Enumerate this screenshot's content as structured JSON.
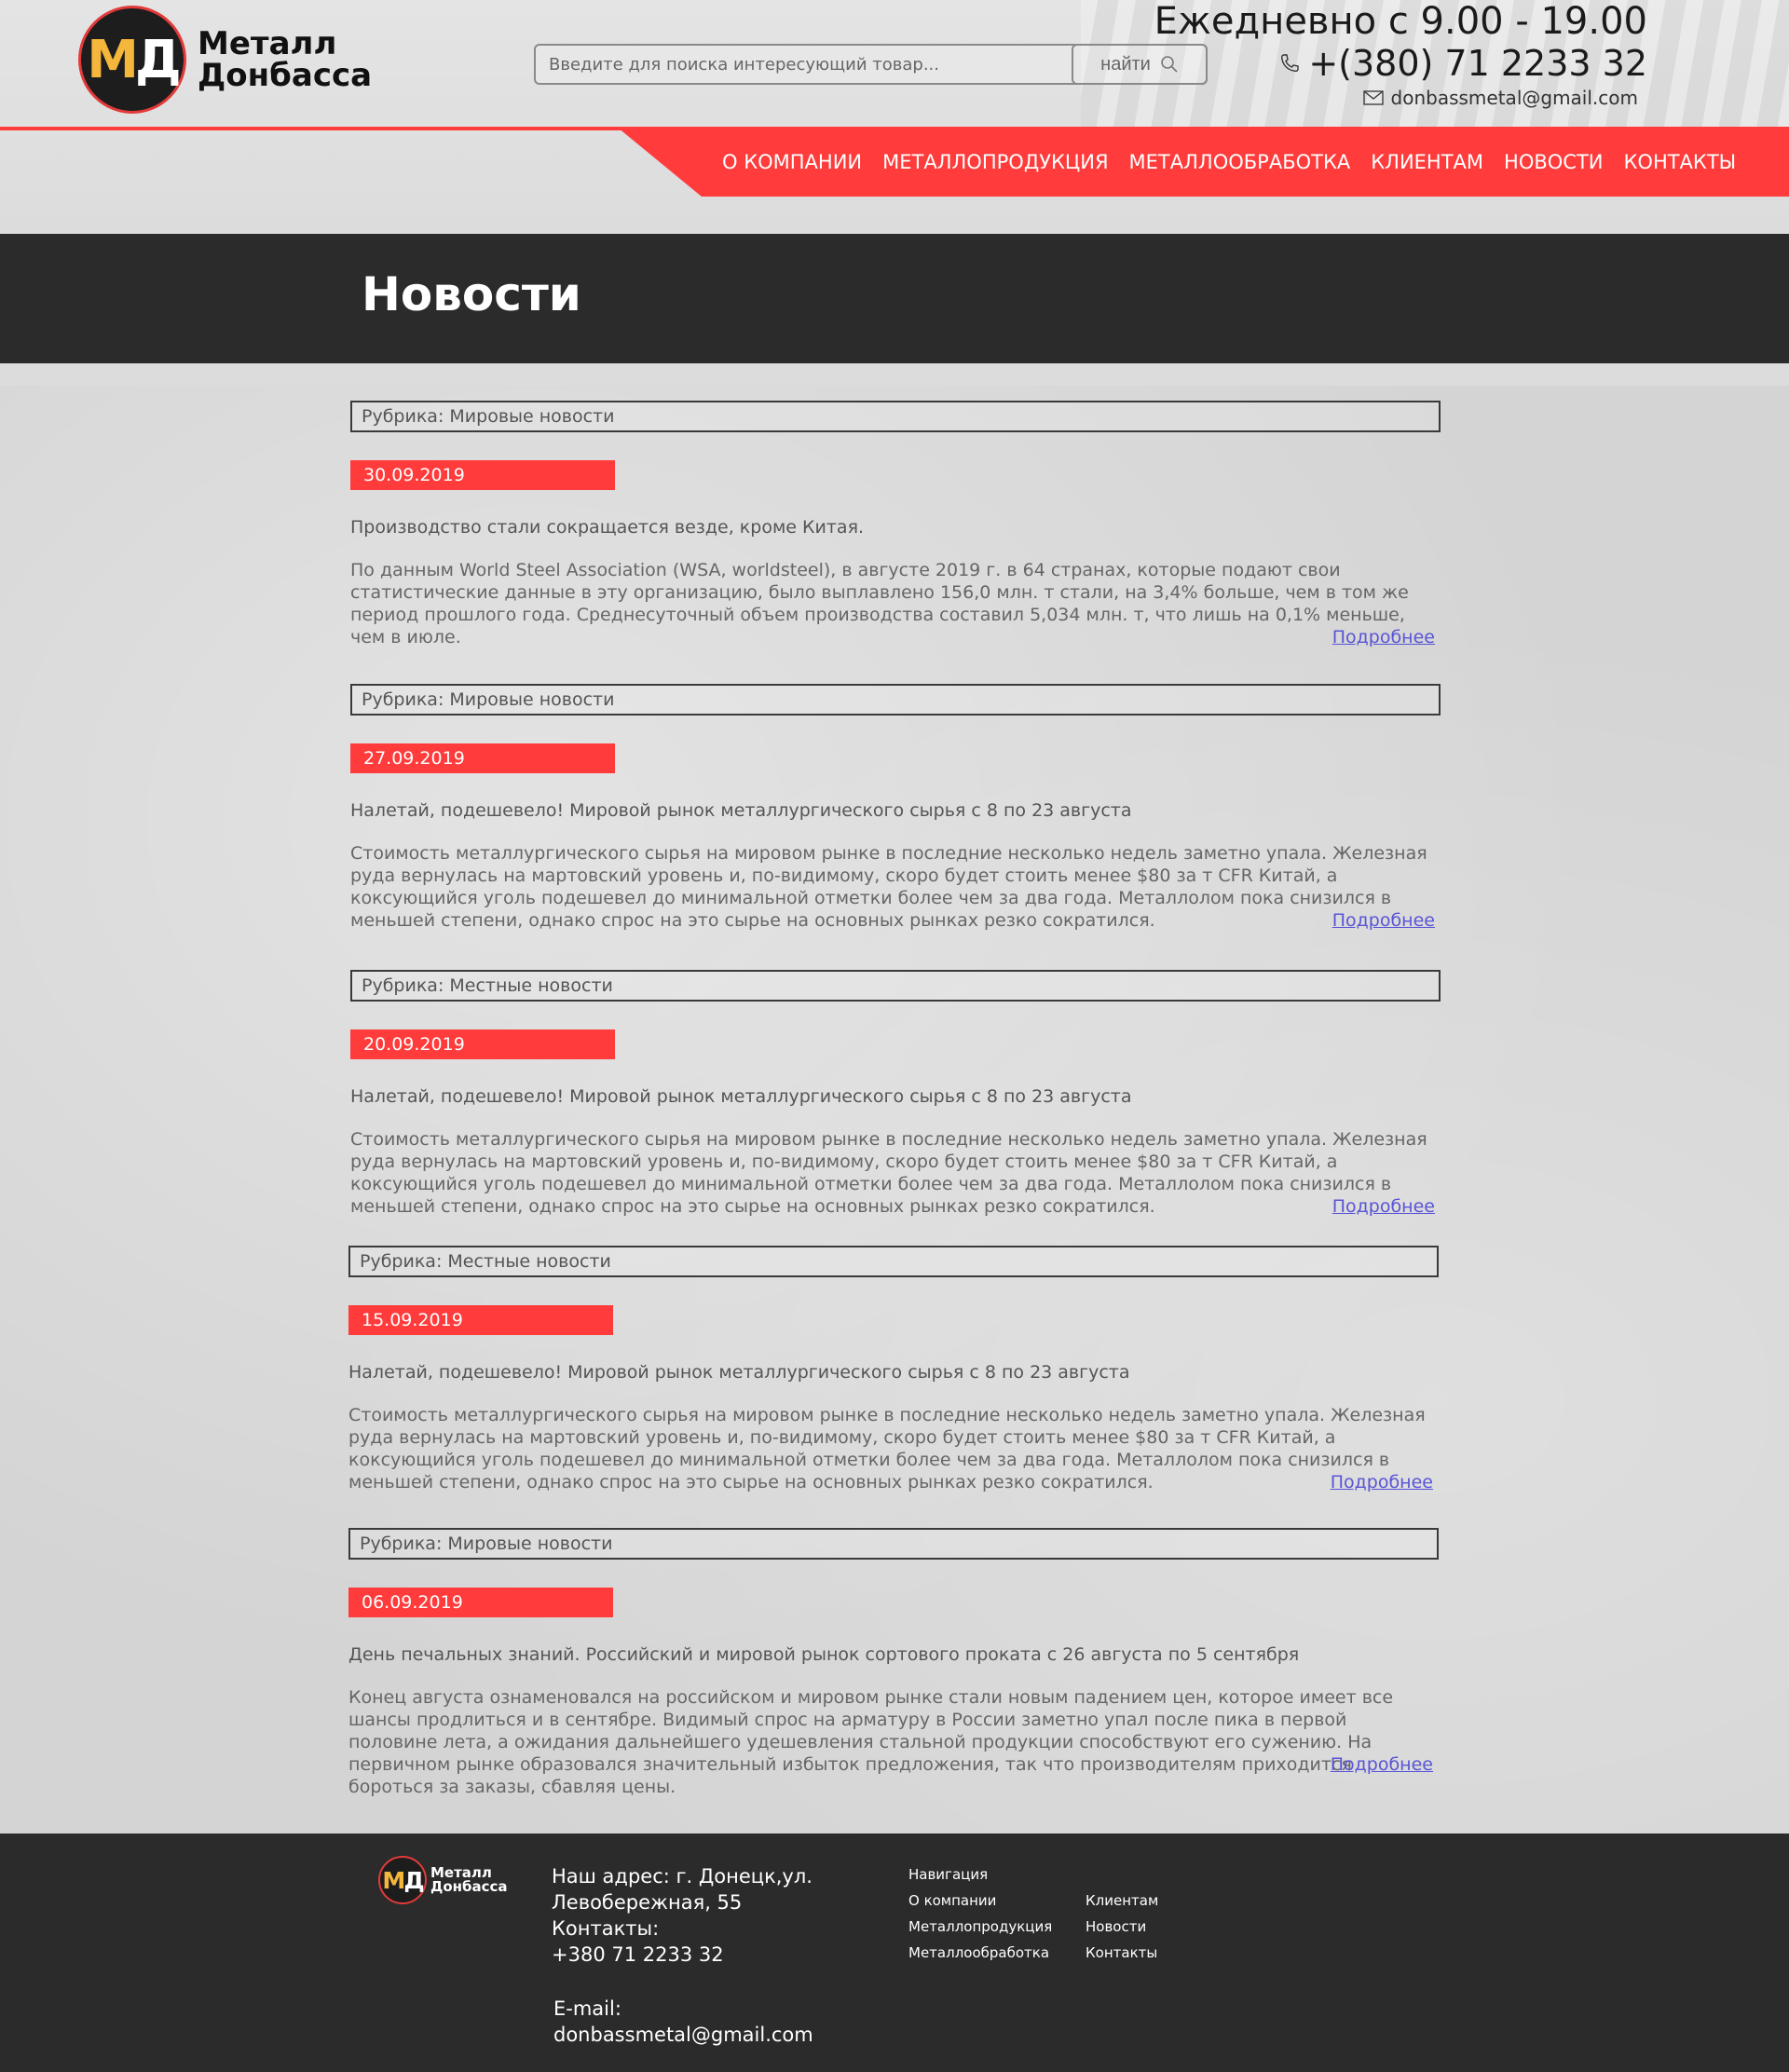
{
  "header": {
    "logo": {
      "mark_m": "М",
      "mark_d": "Д",
      "line1": "Металл",
      "line2": "Донбасса"
    },
    "search": {
      "placeholder": "Введите для поиска интересующий товар...",
      "button_label": "найти"
    },
    "contacts": {
      "hours": "Ежедневно с 9.00 - 19.00",
      "phone": "+(380) 71 2233 32",
      "email": "donbassmetal@gmail.com"
    },
    "nav": [
      "О КОМПАНИИ",
      "МЕТАЛЛОПРОДУКЦИЯ",
      "МЕТАЛЛООБРАБОТКА",
      "КЛИЕНТАМ",
      "НОВОСТИ",
      "КОНТАКТЫ"
    ]
  },
  "page_title": "Новости",
  "more_label": "Подробнее",
  "news": [
    {
      "rubric": "Рубрика: Мировые новости",
      "date": "30.09.2019",
      "title": "Производство стали сокращается везде, кроме Китая.",
      "body": "По данным World Steel Association (WSA, worldsteel), в августе 2019 г. в 64 странах, которые подают свои статистические данные в эту организацию, было выплавлено 156,0 млн. т стали, на 3,4% больше, чем в том же период прошлого года. Среднесуточный объем производства составил 5,034 млн. т, что лишь на 0,1% меньше, чем в июле."
    },
    {
      "rubric": "Рубрика: Мировые новости",
      "date": "27.09.2019",
      "title": "Налетай, подешевело! Мировой рынок металлургического сырья с 8 по 23 августа",
      "body": "Стоимость металлургического сырья на мировом рынке в последние несколько недель заметно упала. Железная руда вернулась на мартовский уровень и, по-видимому, скоро будет стоить менее $80 за т CFR Китай, а коксующийся уголь подешевел до минимальной отметки более чем за два года. Металлолом пока снизился в меньшей степени, однако спрос на это сырье на основных рынках резко сократился."
    },
    {
      "rubric": "Рубрика: Местные новости",
      "date": "20.09.2019",
      "title": "Налетай, подешевело! Мировой рынок металлургического сырья с 8 по 23 августа",
      "body": "Стоимость металлургического сырья на мировом рынке в последние несколько недель заметно упала. Железная руда вернулась на мартовский уровень и, по-видимому, скоро будет стоить менее $80 за т CFR Китай, а коксующийся уголь подешевел до минимальной отметки более чем за два года. Металлолом пока снизился в меньшей степени, однако спрос на это сырье на основных рынках резко сократился."
    },
    {
      "rubric": "Рубрика: Местные новости",
      "date": "15.09.2019",
      "title": "Налетай, подешевело! Мировой рынок металлургического сырья с 8 по 23 августа",
      "body": "Стоимость металлургического сырья на мировом рынке в последние несколько недель заметно упала. Железная руда вернулась на мартовский уровень и, по-видимому, скоро будет стоить менее $80 за т CFR Китай, а коксующийся уголь подешевел до минимальной отметки более чем за два года. Металлолом пока снизился в меньшей степени, однако спрос на это сырье на основных рынках резко сократился."
    },
    {
      "rubric": "Рубрика: Мировые новости",
      "date": "06.09.2019",
      "title": "День печальных знаний. Российский и мировой рынок сортового проката с 26 августа по 5 сентября",
      "body": "Конец августа ознаменовался на российском и мировом рынке стали новым падением цен, которое имеет все шансы продлиться и в сентябре. Видимый спрос на арматуру в России заметно упал после пика в первой половине лета, а ожидания дальнейшего удешевления стальной продукции способствуют его сужению. На первичном рынке образовался значительный избыток предложения, так что производителям приходится бороться за заказы, сбавляя цены."
    }
  ],
  "footer": {
    "logo": {
      "mark_m": "М",
      "mark_d": "Д",
      "line1": "Металл",
      "line2": "Донбасса"
    },
    "address_line1": "Наш адрес: г. Донецк,ул.",
    "address_line2": "Левобережная, 55",
    "contacts_label": "Контакты:",
    "phone": "+380 71 2233 32",
    "email_label": "E-mail:",
    "email": "donbassmetal@gmail.com",
    "nav_col1": [
      "Навигация",
      "О компании",
      "Металлопродукция",
      "Металлообработка"
    ],
    "nav_col2": [
      "Клиентам",
      "Новости",
      "Контакты"
    ]
  },
  "colors": {
    "accent": "#ff3b3b",
    "dark_band": "#2b2b2b",
    "logo_yellow": "#f4b63b",
    "link": "#5a55d6"
  },
  "icons": [
    "search-icon",
    "phone-icon",
    "mail-icon"
  ]
}
